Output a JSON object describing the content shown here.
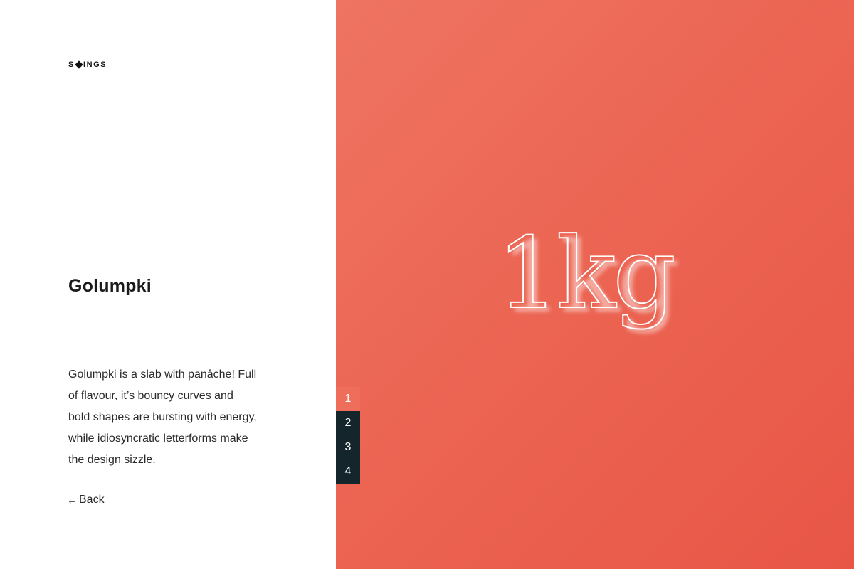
{
  "brand": {
    "logo_left": "S",
    "logo_right": "INGS"
  },
  "font": {
    "title": "Golumpki",
    "description_lines": [
      "Golumpki is a slab with panâche! Full",
      "of flavour, it’s bouncy curves and",
      "bold shapes are bursting with energy,",
      "while idiosyncratic letterforms make",
      "the design sizzle."
    ]
  },
  "nav": {
    "back_arrow": "←",
    "back_label": "Back"
  },
  "specimen": {
    "text": "1kg"
  },
  "pager": {
    "items": [
      "1",
      "2",
      "3",
      "4"
    ],
    "active_index": 0
  },
  "colors": {
    "accent": "#ec6553",
    "pager_background": "#14262c",
    "text": "#1d1d1d"
  },
  "icons": {
    "logo_mark": "diamond-icon",
    "back": "arrow-left-icon"
  }
}
